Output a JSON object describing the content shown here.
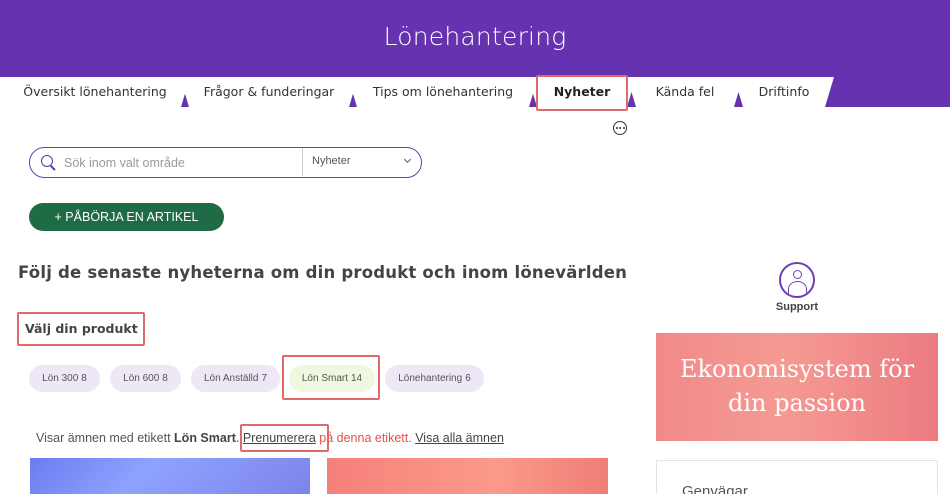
{
  "header": {
    "title": "Lönehantering"
  },
  "tabs": [
    {
      "label": "Översikt lönehantering"
    },
    {
      "label": "Frågor & funderingar"
    },
    {
      "label": "Tips om lönehantering"
    },
    {
      "label": "Nyheter",
      "active": true
    },
    {
      "label": "Kända fel"
    },
    {
      "label": "Driftinfo"
    }
  ],
  "search": {
    "placeholder": "Sök inom valt område",
    "scope": "Nyheter"
  },
  "actions": {
    "new_article": "+ PÅBÖRJA EN ARTIKEL"
  },
  "main": {
    "heading": "Följ de senaste nyheterna om din produkt och inom lönevärlden",
    "choose_product": "Välj din produkt",
    "products": [
      {
        "label": "Lön 300",
        "count": "8"
      },
      {
        "label": "Lön 600",
        "count": "8"
      },
      {
        "label": "Lön Anställd",
        "count": "7"
      },
      {
        "label": "Lön Smart",
        "count": "14",
        "active": true
      },
      {
        "label": "Lönehantering",
        "count": "6"
      }
    ],
    "filter": {
      "prefix": "Visar ämnen med etikett",
      "tag": "Lön Smart",
      "dot": ".",
      "subscribe": "Prenumerera",
      "suffix": "på denna etikett.",
      "show_all": "Visa alla ämnen"
    }
  },
  "sidebar": {
    "support_label": "Support",
    "banner_line1": "Ekonomisystem för",
    "banner_line2": "din passion",
    "shortcuts_title": "Genvägar"
  },
  "colors": {
    "brand_purple": "#6633b0",
    "primary_green": "#1f6b45",
    "highlight_red": "#e06a6a",
    "chip_bg": "#ede7f6",
    "chip_active_bg": "#eef7df"
  }
}
